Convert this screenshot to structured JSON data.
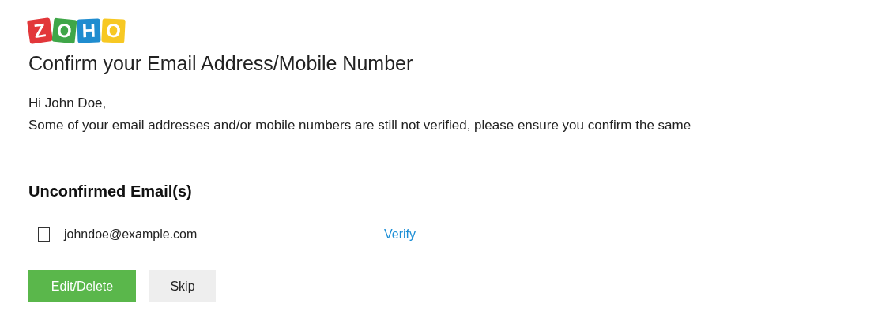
{
  "logo": {
    "letters": [
      {
        "char": "Z",
        "color": "#e2373a"
      },
      {
        "char": "O",
        "color": "#3fa648"
      },
      {
        "char": "H",
        "color": "#1f8ccf"
      },
      {
        "char": "O",
        "color": "#f7c823"
      }
    ]
  },
  "title": "Confirm your Email Address/Mobile Number",
  "greeting": "Hi John Doe,",
  "message": "Some of your email addresses and/or mobile numbers are still not verified, please ensure you confirm the same",
  "section_heading": "Unconfirmed Email(s)",
  "emails": [
    {
      "address": "johndoe@example.com",
      "checked": false,
      "action": "Verify"
    }
  ],
  "buttons": [
    {
      "label": "Edit/Delete",
      "kind": "primary"
    },
    {
      "label": "Skip",
      "kind": "secondary"
    }
  ]
}
